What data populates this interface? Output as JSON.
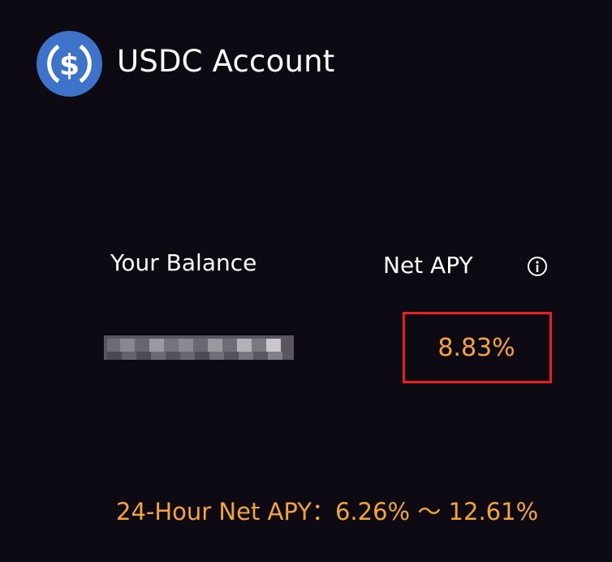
{
  "account": {
    "title": "USDC Account",
    "icon": "usdc-dollar-icon"
  },
  "balance": {
    "label": "Your Balance",
    "value_state": "pixelated"
  },
  "net_apy": {
    "label": "Net APY",
    "value": "8.83%",
    "info_icon": "info-icon"
  },
  "range": {
    "label": "24-Hour Net APY：",
    "low": "6.26%",
    "separator": " ～ ",
    "high": "12.61%"
  },
  "colors": {
    "background": "#0e0a14",
    "accent_orange": "#f3a43a",
    "highlight_red": "#e5201f",
    "usdc_blue": "#3d74c9"
  }
}
